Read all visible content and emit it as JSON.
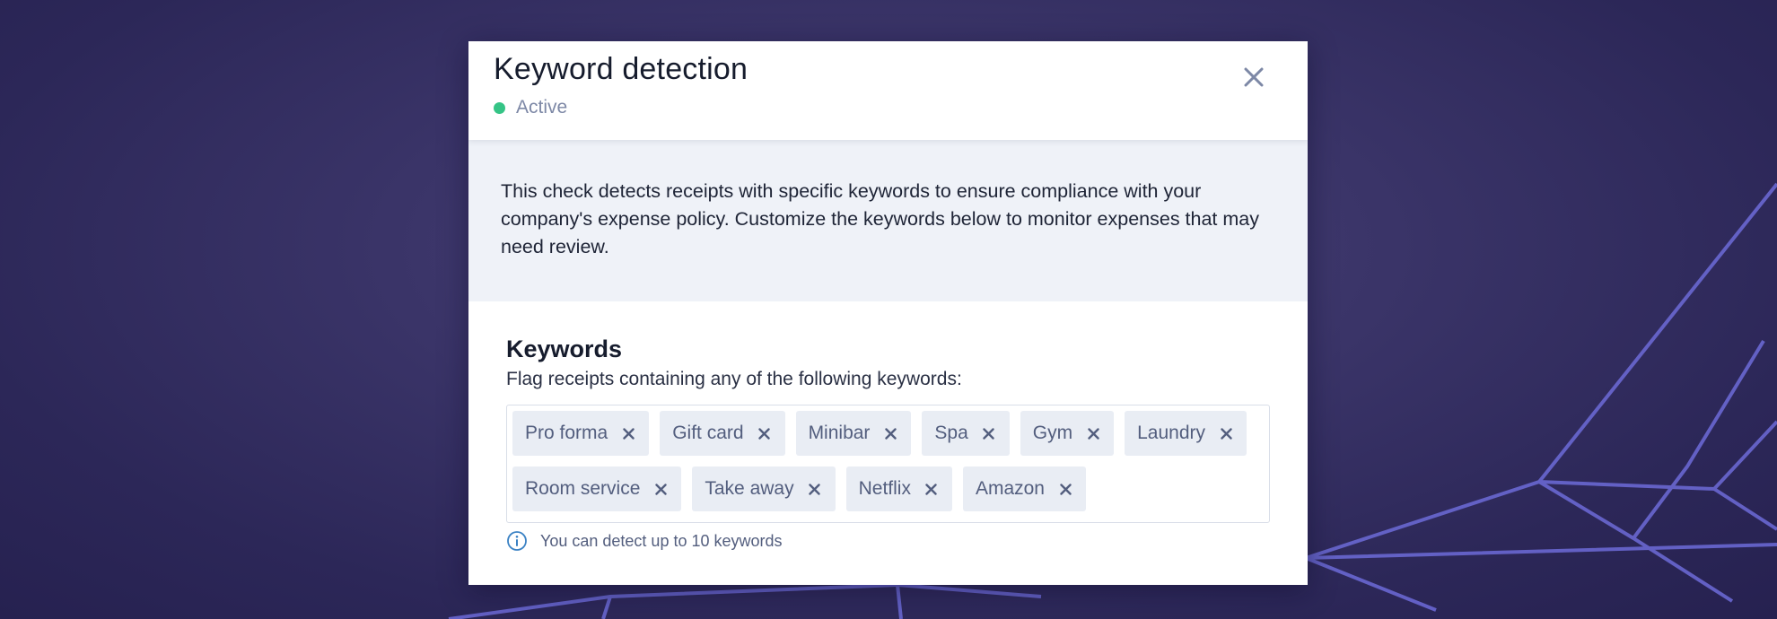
{
  "modal": {
    "title": "Keyword detection",
    "status": "Active",
    "status_color": "#35c486",
    "close_icon": "close-icon"
  },
  "description": "This check detects receipts with specific keywords to ensure compliance with your company's expense policy. Customize the keywords below to monitor expenses that may need review.",
  "keywords": {
    "title": "Keywords",
    "subtitle": "Flag receipts containing any of the following keywords:",
    "tags": [
      {
        "label": "Pro forma"
      },
      {
        "label": "Gift card"
      },
      {
        "label": "Minibar"
      },
      {
        "label": "Spa"
      },
      {
        "label": "Gym"
      },
      {
        "label": "Laundry"
      },
      {
        "label": "Room service"
      },
      {
        "label": "Take away"
      },
      {
        "label": "Netflix"
      },
      {
        "label": "Amazon"
      }
    ],
    "remove_icon": "close-icon",
    "hint_icon": "info-icon",
    "hint": "You can detect up to 10 keywords"
  },
  "colors": {
    "accent_info": "#3b82c4",
    "background": "#2c2758"
  }
}
